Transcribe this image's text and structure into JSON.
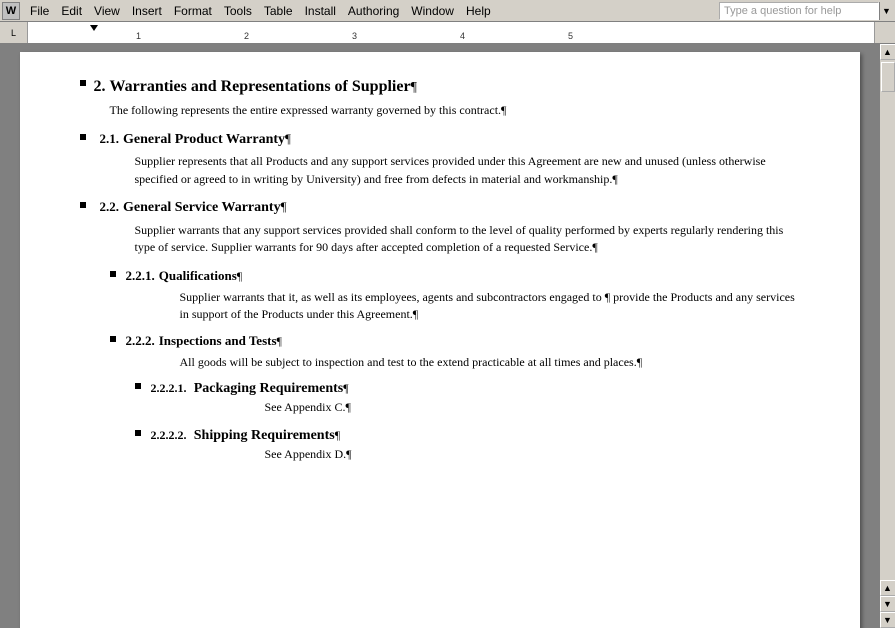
{
  "menubar": {
    "logo": "W",
    "items": [
      "File",
      "Edit",
      "View",
      "Insert",
      "Format",
      "Tools",
      "Table",
      "Install",
      "Authoring",
      "Window",
      "Help"
    ],
    "help_placeholder": "Type a question for help"
  },
  "ruler": {
    "marks": [
      "1",
      "2",
      "3",
      "4",
      "5"
    ]
  },
  "document": {
    "section2": {
      "number": "2.",
      "title": "Warranties and Representations of Supplier",
      "pilcrow": "¶",
      "body": "The following represents the entire expressed warranty governed by this contract.¶"
    },
    "section21": {
      "number": "2.1.",
      "title": "General Product Warranty",
      "pilcrow": "¶",
      "body": "Supplier represents that all Products and any support services provided under this Agreement are new and unused (unless otherwise specified or agreed to in writing by University) and free from defects in material and workmanship.¶"
    },
    "section22": {
      "number": "2.2.",
      "title": "General Service Warranty",
      "pilcrow": "¶",
      "body": "Supplier warrants that any support services provided shall conform to the level of quality performed by experts regularly rendering this type of service.  Supplier warrants for 90 days after accepted completion of a requested Service.¶"
    },
    "section221": {
      "number": "2.2.1.",
      "title": "Qualifications",
      "pilcrow": "¶",
      "body": "Supplier warrants that it, as well as its employees, agents and subcontractors engaged to ¶\nprovide the Products and any services in support of the Products under this Agreement.¶"
    },
    "section222": {
      "number": "2.2.2.",
      "title": "Inspections and Tests",
      "pilcrow": "¶",
      "body": "All goods will be subject to inspection and test to the extend practicable at all times and places.¶"
    },
    "section2221": {
      "number": "2.2.2.1.",
      "title": "Packaging Requirements",
      "pilcrow": "¶",
      "body": "See Appendix C.¶"
    },
    "section2222": {
      "number": "2.2.2.2.",
      "title": "Shipping Requirements",
      "pilcrow": "¶",
      "body": "See Appendix D.¶"
    }
  }
}
